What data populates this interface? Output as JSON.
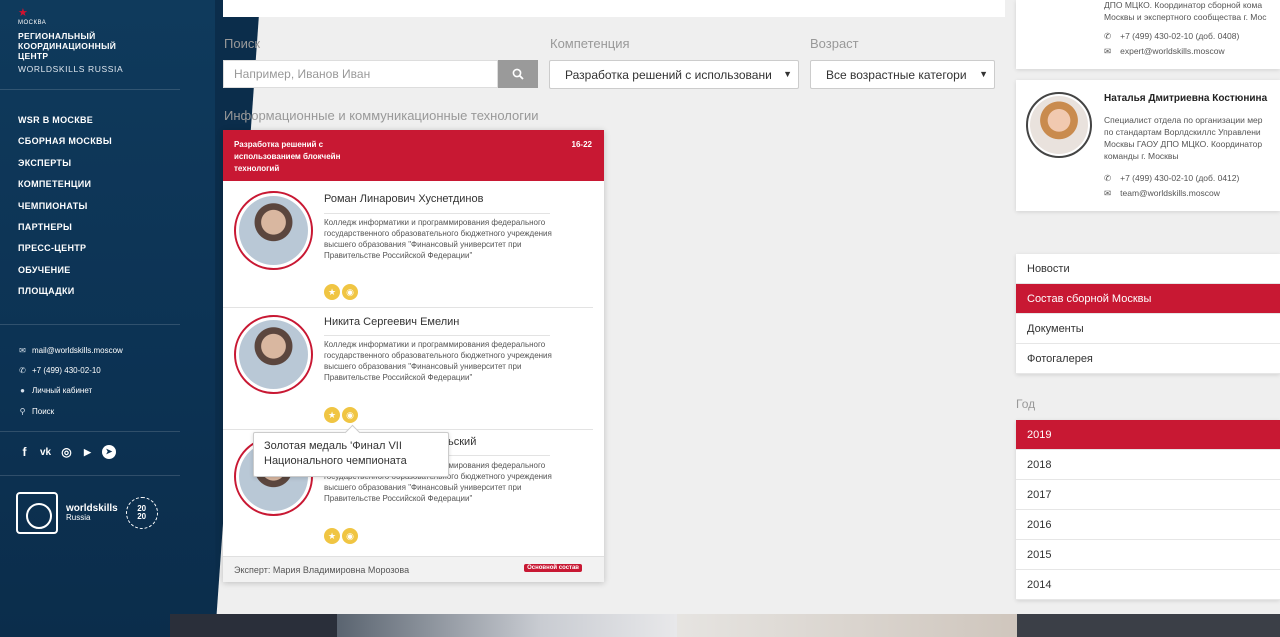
{
  "sidebar": {
    "moskva": "МОСКВА",
    "brand_title": "РЕГИОНАЛЬНЫЙ\nКООРДИНАЦИОННЫЙ\nЦЕНТР",
    "brand_sub": "WORLDSKILLS RUSSIA",
    "nav": [
      "WSR В МОСКВЕ",
      "СБОРНАЯ МОСКВЫ",
      "ЭКСПЕРТЫ",
      "КОМПЕТЕНЦИИ",
      "ЧЕМПИОНАТЫ",
      "ПАРТНЕРЫ",
      "ПРЕСС-ЦЕНТР",
      "ОБУЧЕНИЕ",
      "ПЛОЩАДКИ"
    ],
    "contacts": {
      "email": "mail@worldskills.moscow",
      "phone": "+7 (499) 430-02-10",
      "cabinet": "Личный кабинет",
      "search": "Поиск"
    },
    "logo_ws": "worldskills",
    "logo_ws_sub": "Russia",
    "logo_2020": "20\n20"
  },
  "filters": {
    "search_label": "Поиск",
    "search_placeholder": "Например, Иванов Иван",
    "competence_label": "Компетенция",
    "competence_value": "Разработка решений с использовани",
    "age_label": "Возраст",
    "age_value": "Все возрастные категори"
  },
  "section_title": "Информационные и коммуникационные технологии",
  "card": {
    "competence": "Разработка решений с использованием блокчейн технологий",
    "age": "16-22",
    "members": [
      {
        "name": "Роман Линарович Хуснетдинов",
        "org": "Колледж информатики и программирования федерального государственного образовательного бюджетного учреждения высшего образования \"Финансовый университет при Правительстве Российской Федерации\""
      },
      {
        "name": "Никита Сергеевич Емелин",
        "org": "Колледж информатики и программирования федерального государственного образовательного бюджетного учреждения высшего образования \"Финансовый университет при Правительстве Российской Федерации\""
      },
      {
        "name": "ьский",
        "org": "Колледж информатики и программирования федерального государственного образовательного бюджетного учреждения высшего образования \"Финансовый университет при Правительстве Российской Федерации\""
      }
    ],
    "expert": "Эксперт: Мария Владимировна Морозова",
    "tag": "Основной состав"
  },
  "tooltip": "Золотая медаль 'Финал VII Национального чемпионата",
  "right": {
    "p1_text": [
      "ДПО МЦКО. Координатор сборной кома",
      "Москвы и экспертного сообщества г. Мос"
    ],
    "p1_phone": "+7 (499) 430-02-10 (доб. 0408)",
    "p1_email": "expert@worldskills.moscow",
    "p2_name": "Наталья Дмитриевна Костюнина",
    "p2_text": [
      "Специалист отдела по организации мер",
      "по стандартам Ворлдскиллс Управлени",
      "Москвы ГАОУ ДПО МЦКО. Координатор",
      "команды г. Москвы"
    ],
    "p2_phone": "+7 (499) 430-02-10 (доб. 0412)",
    "p2_email": "team@worldskills.moscow",
    "menu": [
      "Новости",
      "Состав сборной Москвы",
      "Документы",
      "Фотогалерея"
    ],
    "menu_active": 1,
    "year_label": "Год",
    "years": [
      "2019",
      "2018",
      "2017",
      "2016",
      "2015",
      "2014"
    ],
    "year_active": 0
  },
  "colors": {
    "accent": "#c81833",
    "sidebar": "#0c3253",
    "medal": "#f0c543"
  }
}
